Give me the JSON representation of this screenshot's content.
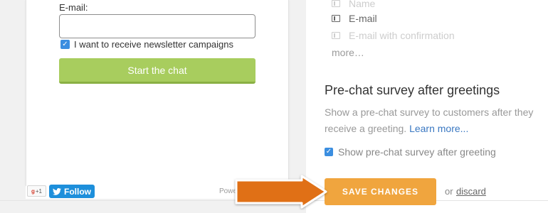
{
  "widget": {
    "email_label": "E-mail:",
    "email_value": "",
    "newsletter_label": "I want to receive newsletter campaigns",
    "newsletter_checked": true,
    "start_chat_label": "Start the chat",
    "start_chat_color": "#a8cd5e",
    "footer": {
      "gplus_count": "+1",
      "twitter_follow_label": "Follow",
      "powered_text": "Powe"
    }
  },
  "fields": {
    "options": [
      {
        "label": "Name",
        "enabled": false,
        "icon": "field-icon"
      },
      {
        "label": "E-mail",
        "enabled": true,
        "icon": "field-icon"
      },
      {
        "label": "E-mail with confirmation",
        "enabled": false,
        "icon": "field-icon"
      }
    ],
    "more_label": "more…"
  },
  "survey": {
    "heading": "Pre-chat survey after greetings",
    "description": "Show a pre-chat survey to customers after they receive a greeting.",
    "learn_more": "Learn more...",
    "checkbox_label": "Show pre-chat survey after greeting",
    "checkbox_checked": true
  },
  "actions": {
    "save_label": "SAVE CHANGES",
    "save_color": "#f0a53e",
    "or_text": "or",
    "discard_label": "discard"
  },
  "annotation": {
    "arrow_color": "#e06f12",
    "arrow_icon": "arrow-right-icon"
  }
}
